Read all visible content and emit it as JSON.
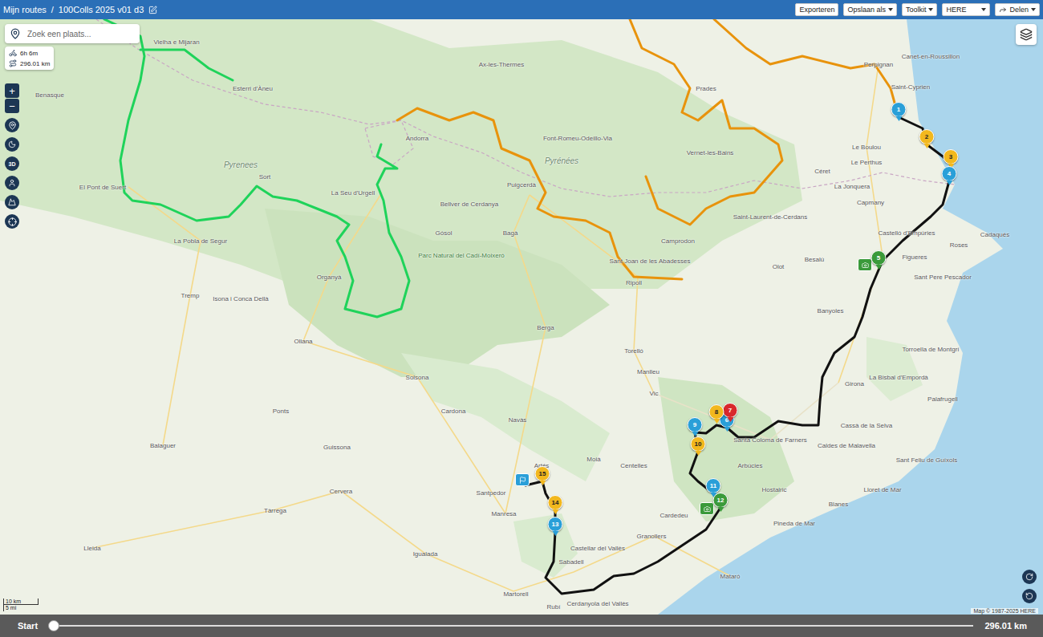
{
  "app_bar": {
    "breadcrumb": [
      "Mijn routes",
      "100Colls 2025 v01 d3"
    ],
    "separator": "/",
    "actions": [
      {
        "label": "Exporteren",
        "kind": "button"
      },
      {
        "label": "Opslaan als",
        "kind": "menu"
      },
      {
        "label": "Toolkit",
        "kind": "menu"
      },
      {
        "label": "HERE",
        "kind": "select"
      },
      {
        "label": "Delen",
        "kind": "share"
      }
    ]
  },
  "search": {
    "placeholder": "Zoek een plaats..."
  },
  "stats": {
    "duration": "6h 6m",
    "distance": "296.01 km"
  },
  "map_controls": {
    "zoom_in": "+",
    "zoom_out": "−",
    "view_3d": "3D"
  },
  "routes": [
    {
      "name": "green",
      "color": "#1fd35a"
    },
    {
      "name": "orange-west",
      "color": "#e8930c"
    },
    {
      "name": "orange-east",
      "color": "#e8930c"
    },
    {
      "name": "day-3",
      "color": "#111111"
    }
  ],
  "markers": [
    {
      "label": "1",
      "color": "#2a9fd8"
    },
    {
      "label": "2",
      "color": "#f2b81e"
    },
    {
      "label": "3",
      "color": "#f2b81e"
    },
    {
      "label": "4",
      "color": "#2a9fd8"
    },
    {
      "label": "5",
      "color": "#3a9a3a"
    },
    {
      "label": "6",
      "color": "#2a9fd8"
    },
    {
      "label": "7",
      "color": "#d8282c"
    },
    {
      "label": "8",
      "color": "#f2b81e"
    },
    {
      "label": "9",
      "color": "#2a9fd8"
    },
    {
      "label": "10",
      "color": "#f2b81e"
    },
    {
      "label": "11",
      "color": "#2a9fd8"
    },
    {
      "label": "12",
      "color": "#3a9a3a"
    },
    {
      "label": "13",
      "color": "#2a9fd8"
    },
    {
      "label": "14",
      "color": "#f2b81e"
    },
    {
      "label": "15",
      "color": "#f2b81e"
    }
  ],
  "labels": [
    {
      "text": "Perpignan",
      "kind": "town"
    },
    {
      "text": "Canet-en-Roussillon",
      "kind": "town"
    },
    {
      "text": "Saint-Cyprien",
      "kind": "town"
    },
    {
      "text": "Le Boulou",
      "kind": "town"
    },
    {
      "text": "Céret",
      "kind": "town"
    },
    {
      "text": "Le Perthus",
      "kind": "town"
    },
    {
      "text": "La Jonquera",
      "kind": "town"
    },
    {
      "text": "Capmany",
      "kind": "town"
    },
    {
      "text": "Figueres",
      "kind": "town"
    },
    {
      "text": "Roses",
      "kind": "town"
    },
    {
      "text": "Cadaqués",
      "kind": "town"
    },
    {
      "text": "Castelló d'Empúries",
      "kind": "town"
    },
    {
      "text": "Sant Pere Pescador",
      "kind": "town"
    },
    {
      "text": "Besalú",
      "kind": "town"
    },
    {
      "text": "Olot",
      "kind": "town"
    },
    {
      "text": "Banyoles",
      "kind": "town"
    },
    {
      "text": "Torroella de Montgrí",
      "kind": "town"
    },
    {
      "text": "La Bisbal d'Empordà",
      "kind": "town"
    },
    {
      "text": "Girona",
      "kind": "town"
    },
    {
      "text": "Palafrugell",
      "kind": "town"
    },
    {
      "text": "Cassà de la Selva",
      "kind": "town"
    },
    {
      "text": "Santa Coloma de Farners",
      "kind": "town"
    },
    {
      "text": "Caldes de Malavella",
      "kind": "town"
    },
    {
      "text": "Sant Feliu de Guíxols",
      "kind": "town"
    },
    {
      "text": "Lloret de Mar",
      "kind": "town"
    },
    {
      "text": "Hostalric",
      "kind": "town"
    },
    {
      "text": "Arbúcies",
      "kind": "town"
    },
    {
      "text": "Blanes",
      "kind": "town"
    },
    {
      "text": "Pineda de Mar",
      "kind": "town"
    },
    {
      "text": "Mataró",
      "kind": "town"
    },
    {
      "text": "Granollers",
      "kind": "town"
    },
    {
      "text": "Cardedeu",
      "kind": "town"
    },
    {
      "text": "Sabadell",
      "kind": "town"
    },
    {
      "text": "Cerdanyola del Vallès",
      "kind": "town"
    },
    {
      "text": "Rubí",
      "kind": "town"
    },
    {
      "text": "Martorell",
      "kind": "town"
    },
    {
      "text": "Castellar del Vallès",
      "kind": "town"
    },
    {
      "text": "Manresa",
      "kind": "town"
    },
    {
      "text": "Santpedor",
      "kind": "town"
    },
    {
      "text": "Artés",
      "kind": "town"
    },
    {
      "text": "Navàs",
      "kind": "town"
    },
    {
      "text": "Moià",
      "kind": "town"
    },
    {
      "text": "Centelles",
      "kind": "town"
    },
    {
      "text": "Vic",
      "kind": "town"
    },
    {
      "text": "Manlleu",
      "kind": "town"
    },
    {
      "text": "Torelló",
      "kind": "town"
    },
    {
      "text": "Berga",
      "kind": "town"
    },
    {
      "text": "Solsona",
      "kind": "town"
    },
    {
      "text": "Cardona",
      "kind": "town"
    },
    {
      "text": "Ripoll",
      "kind": "town"
    },
    {
      "text": "Sant Joan de les Abadesses",
      "kind": "town"
    },
    {
      "text": "Camprodon",
      "kind": "town"
    },
    {
      "text": "Saint-Laurent-de-Cerdans",
      "kind": "town"
    },
    {
      "text": "Vernet-les-Bains",
      "kind": "town"
    },
    {
      "text": "Prades",
      "kind": "town"
    },
    {
      "text": "Font-Romeu-Odeillo-Via",
      "kind": "town"
    },
    {
      "text": "Ax-les-Thermes",
      "kind": "town"
    },
    {
      "text": "Puigcerdà",
      "kind": "town"
    },
    {
      "text": "Bellver de Cerdanya",
      "kind": "town"
    },
    {
      "text": "Bagà",
      "kind": "town"
    },
    {
      "text": "Gósol",
      "kind": "town"
    },
    {
      "text": "La Seu d'Urgell",
      "kind": "town"
    },
    {
      "text": "Andorra",
      "kind": "town"
    },
    {
      "text": "Organyà",
      "kind": "town"
    },
    {
      "text": "Oliana",
      "kind": "town"
    },
    {
      "text": "Sort",
      "kind": "town"
    },
    {
      "text": "El Pont de Suert",
      "kind": "town"
    },
    {
      "text": "La Pobla de Segur",
      "kind": "town"
    },
    {
      "text": "Tremp",
      "kind": "town"
    },
    {
      "text": "Isona i Conca Dellà",
      "kind": "town"
    },
    {
      "text": "Benasque",
      "kind": "town"
    },
    {
      "text": "Vielha e Mijaran",
      "kind": "town"
    },
    {
      "text": "Esterri d'Àneu",
      "kind": "town"
    },
    {
      "text": "Balaguer",
      "kind": "town"
    },
    {
      "text": "Lleida",
      "kind": "town"
    },
    {
      "text": "Tàrrega",
      "kind": "town"
    },
    {
      "text": "Cervera",
      "kind": "town"
    },
    {
      "text": "Igualada",
      "kind": "town"
    },
    {
      "text": "Guissona",
      "kind": "town"
    },
    {
      "text": "Ponts",
      "kind": "town"
    },
    {
      "text": "Parc Natural del Cadí-Moixeró",
      "kind": "park"
    },
    {
      "text": "Pyrenees",
      "kind": "region"
    },
    {
      "text": "Pyrénées",
      "kind": "region"
    }
  ],
  "scale": {
    "metric": "10 km",
    "imperial": "5 mi"
  },
  "attribution": "Map © 1987-2025 HERE",
  "timeline": {
    "start": "Start",
    "end": "296.01 km",
    "level": 0
  }
}
